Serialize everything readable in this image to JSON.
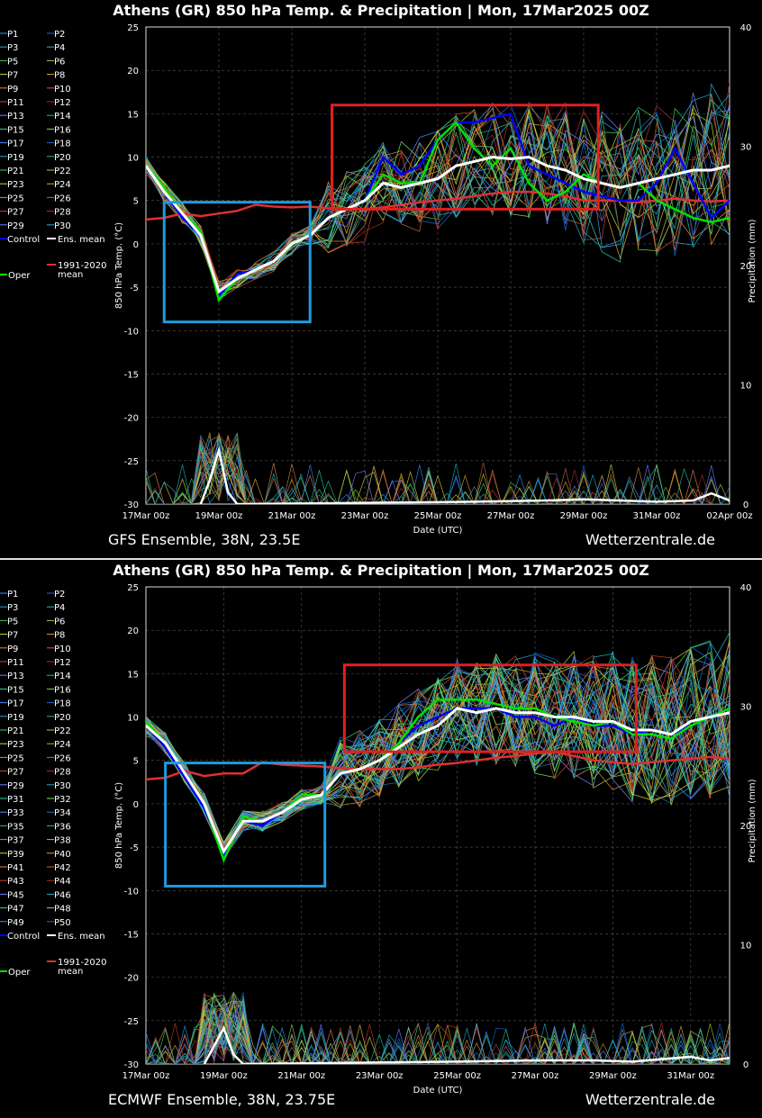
{
  "panels": [
    {
      "id": "gfs",
      "title": "Athens  (GR)  850 hPa Temp. & Precipitation | Mon, 17Mar2025 00Z",
      "footer_left": "GFS Ensemble, 38N, 23.5E",
      "footer_right": "Wetterzentrale.de",
      "members": 30
    },
    {
      "id": "ecmwf",
      "title": "Athens  (GR)  850 hPa Temp. & Precipitation | Mon, 17Mar2025 00Z",
      "footer_left": "ECMWF Ensemble, 38N, 23.75E",
      "footer_right": "Wetterzentrale.de",
      "members": 50
    }
  ],
  "legend": {
    "control": "Control",
    "ens_mean": "Ens. mean",
    "oper": "Oper",
    "clim": "1991-2020 mean"
  },
  "colors": {
    "control": "#0000ff",
    "ens_mean": "#ffffff",
    "oper": "#00e000",
    "clim": "#e03030",
    "red_box": "#e02020",
    "blue_box": "#1e9be0"
  },
  "chart_data": [
    {
      "type": "line",
      "model": "GFS Ensemble",
      "ylabel": "850 hPa Temp. (°C)",
      "y2label": "Precipitation (mm)",
      "xlabel": "Date (UTC)",
      "ylim": [
        -30,
        25
      ],
      "y2lim": [
        0,
        40
      ],
      "xlim_days": [
        0,
        16
      ],
      "grid": true,
      "x_ticks": [
        "17Mar 00z",
        "19Mar 00z",
        "21Mar 00z",
        "23Mar 00z",
        "25Mar 00z",
        "27Mar 00z",
        "29Mar 00z",
        "31Mar 00z",
        "02Apr 00z"
      ],
      "y_ticks": [
        25,
        20,
        15,
        10,
        5,
        0,
        -5,
        -10,
        -15,
        -20,
        -25,
        -30
      ],
      "y2_ticks": [
        40,
        30,
        20,
        10,
        0
      ],
      "series": [
        {
          "name": "Ens. mean",
          "x": [
            0,
            0.5,
            1,
            1.5,
            2,
            2.5,
            3,
            3.5,
            4,
            4.5,
            5,
            5.5,
            6,
            6.5,
            7,
            7.5,
            8,
            8.5,
            9,
            9.5,
            10,
            10.5,
            11,
            11.5,
            12,
            12.5,
            13,
            13.5,
            14,
            14.5,
            15,
            15.5,
            16
          ],
          "y": [
            9,
            6,
            3.5,
            1,
            -5.5,
            -4,
            -3,
            -2,
            0,
            1,
            3,
            4,
            5,
            7,
            6.5,
            7,
            7.5,
            9,
            9.5,
            10,
            9.8,
            10,
            9,
            8.5,
            7.5,
            7,
            6.5,
            7,
            7.5,
            8,
            8.5,
            8.5,
            9
          ]
        },
        {
          "name": "Control",
          "x": [
            0,
            0.5,
            1,
            1.5,
            2,
            2.5,
            3,
            3.5,
            4,
            4.5,
            5,
            5.5,
            6,
            6.5,
            7,
            7.5,
            8,
            8.5,
            9,
            9.5,
            10,
            10.5,
            11,
            11.5,
            12,
            12.5,
            13,
            13.5,
            14,
            14.5,
            15,
            15.5,
            16
          ],
          "y": [
            9,
            6,
            3,
            1,
            -6,
            -3.5,
            -3,
            -2,
            0,
            1,
            3,
            4,
            5,
            10,
            8,
            9,
            12,
            14,
            14,
            14.5,
            15,
            9,
            8,
            7,
            6,
            5.5,
            5,
            5,
            7,
            11,
            7,
            3,
            5
          ]
        },
        {
          "name": "Oper",
          "x": [
            0,
            0.5,
            1,
            1.5,
            2,
            2.5,
            3,
            3.5,
            4,
            4.5,
            5,
            5.5,
            6,
            6.5,
            7,
            7.5,
            8,
            8.5,
            9,
            9.5,
            10,
            10.5,
            11,
            11.5,
            12,
            12.5,
            13,
            13.5,
            14,
            14.5,
            15,
            15.5,
            16
          ],
          "y": [
            9,
            6.5,
            3.5,
            1.5,
            -6.5,
            -4,
            -3,
            -2,
            0,
            1,
            3,
            4,
            5,
            8,
            7,
            7,
            12,
            14,
            11,
            9,
            11,
            7,
            5,
            6,
            8,
            7,
            6.5,
            7,
            5,
            4,
            3,
            2.5,
            3
          ]
        },
        {
          "name": "1991-2020 mean",
          "x": [
            0,
            0.5,
            1,
            1.5,
            2,
            2.5,
            3,
            3.5,
            4,
            4.5,
            5,
            5.5,
            6,
            6.5,
            7,
            7.5,
            8,
            8.5,
            9,
            9.5,
            10,
            10.5,
            11,
            11.5,
            12,
            12.5,
            13,
            13.5,
            14,
            14.5,
            15,
            15.5,
            16
          ],
          "y": [
            2.8,
            3,
            3.5,
            3.2,
            3.5,
            3.8,
            4.5,
            4.3,
            4.2,
            4.3,
            4.1,
            4,
            4,
            4.2,
            4.5,
            4.8,
            5,
            5.2,
            5.5,
            5.8,
            6,
            6,
            5.8,
            5.5,
            5,
            5,
            5,
            4.8,
            5,
            5.2,
            5,
            4.9,
            5
          ]
        },
        {
          "name": "Ens. mean precipitation (mm)",
          "x": [
            1.5,
            1.75,
            2,
            2.25,
            2.5,
            9,
            11,
            12,
            14,
            15,
            15.5,
            16
          ],
          "y": [
            0,
            2,
            4.5,
            1,
            0,
            0.2,
            0.3,
            0.4,
            0.2,
            0.3,
            0.9,
            0.3
          ]
        }
      ],
      "boxes": [
        {
          "color": "blue",
          "x": [
            0.5,
            4.5
          ],
          "y": [
            -9,
            4.8
          ]
        },
        {
          "color": "red",
          "x": [
            5.1,
            12.4
          ],
          "y": [
            4,
            16
          ]
        }
      ]
    },
    {
      "type": "line",
      "model": "ECMWF Ensemble",
      "ylabel": "850 hPa Temp. (°C)",
      "y2label": "Precipitation (mm)",
      "xlabel": "Date (UTC)",
      "ylim": [
        -30,
        25
      ],
      "y2lim": [
        0,
        40
      ],
      "xlim_days": [
        0,
        15
      ],
      "grid": true,
      "x_ticks": [
        "17Mar 00z",
        "19Mar 00z",
        "21Mar 00z",
        "23Mar 00z",
        "25Mar 00z",
        "27Mar 00z",
        "29Mar 00z",
        "31Mar 00z"
      ],
      "y_ticks": [
        25,
        20,
        15,
        10,
        5,
        0,
        -5,
        -10,
        -15,
        -20,
        -25,
        -30
      ],
      "y2_ticks": [
        40,
        30,
        20,
        10,
        0
      ],
      "series": [
        {
          "name": "Ens. mean",
          "x": [
            0,
            0.5,
            1,
            1.5,
            2,
            2.5,
            3,
            3.5,
            4,
            4.5,
            5,
            5.5,
            6,
            6.5,
            7,
            7.5,
            8,
            8.5,
            9,
            9.5,
            10,
            10.5,
            11,
            11.5,
            12,
            12.5,
            13,
            13.5,
            14,
            14.5,
            15
          ],
          "y": [
            9,
            7,
            3.5,
            0,
            -5.5,
            -2,
            -2,
            -1,
            0.5,
            1,
            3.5,
            4,
            5,
            6.5,
            8,
            9,
            11,
            10.5,
            11,
            10.5,
            10.5,
            10,
            10,
            9.5,
            9.5,
            8.5,
            8.5,
            8,
            9.5,
            10,
            10.5
          ]
        },
        {
          "name": "Control",
          "x": [
            0,
            0.5,
            1,
            1.5,
            2,
            2.5,
            3,
            3.5,
            4,
            4.5,
            5,
            5.5,
            6,
            6.5,
            7,
            7.5,
            8,
            8.5,
            9,
            9.5,
            10,
            10.5,
            11,
            11.5,
            12,
            12.5,
            13,
            13.5,
            14,
            14.5,
            15
          ],
          "y": [
            9,
            6.5,
            3,
            -0.5,
            -6,
            -2,
            -2.5,
            -1,
            0.5,
            1,
            3.5,
            4,
            5,
            7,
            9,
            10,
            11,
            11,
            11,
            10,
            10,
            9,
            10,
            9,
            9,
            8,
            8.5,
            8,
            9,
            10,
            11
          ]
        },
        {
          "name": "Oper",
          "x": [
            0,
            0.5,
            1,
            1.5,
            2,
            2.5,
            3,
            3.5,
            4,
            4.5,
            5,
            5.5,
            6,
            6.5,
            7,
            7.5,
            8,
            8.5,
            9,
            9.5,
            10,
            10.5,
            11,
            11.5,
            12,
            12.5,
            13,
            13.5,
            14,
            14.5,
            15
          ],
          "y": [
            9.5,
            7,
            3.5,
            0,
            -6.5,
            -1.5,
            -2,
            -1,
            1,
            1,
            3.5,
            4,
            5,
            7,
            10,
            12,
            12,
            12,
            11.5,
            11,
            11,
            10,
            9.5,
            9,
            9.5,
            8,
            8,
            7.5,
            9,
            10,
            11
          ]
        },
        {
          "name": "1991-2020 mean",
          "x": [
            0,
            0.5,
            1,
            1.5,
            2,
            2.5,
            3,
            3.5,
            4,
            4.5,
            5,
            5.5,
            6,
            6.5,
            7,
            7.5,
            8,
            8.5,
            9,
            9.5,
            10,
            10.5,
            11,
            11.5,
            12,
            12.5,
            13,
            13.5,
            14,
            14.5,
            15
          ],
          "y": [
            2.8,
            3,
            3.8,
            3.2,
            3.5,
            3.5,
            4.8,
            4.5,
            4.4,
            4.3,
            4.1,
            4,
            4,
            4,
            4.2,
            4.5,
            4.7,
            5,
            5.3,
            5.5,
            5.8,
            6,
            5.5,
            5,
            4.8,
            4.6,
            4.8,
            5,
            5.2,
            5.4,
            5.2
          ]
        },
        {
          "name": "Ens. mean precipitation (mm)",
          "x": [
            1.5,
            1.75,
            2,
            2.25,
            2.5,
            8,
            10,
            11.5,
            12.5,
            14,
            14.5,
            15
          ],
          "y": [
            0,
            1.5,
            3,
            0.8,
            0,
            0.2,
            0.3,
            0.3,
            0.2,
            0.6,
            0.3,
            0.5
          ]
        }
      ],
      "boxes": [
        {
          "color": "blue",
          "x": [
            0.5,
            4.6
          ],
          "y": [
            -9.5,
            4.7
          ]
        },
        {
          "color": "red",
          "x": [
            5.1,
            12.6
          ],
          "y": [
            6,
            16
          ]
        }
      ]
    }
  ]
}
